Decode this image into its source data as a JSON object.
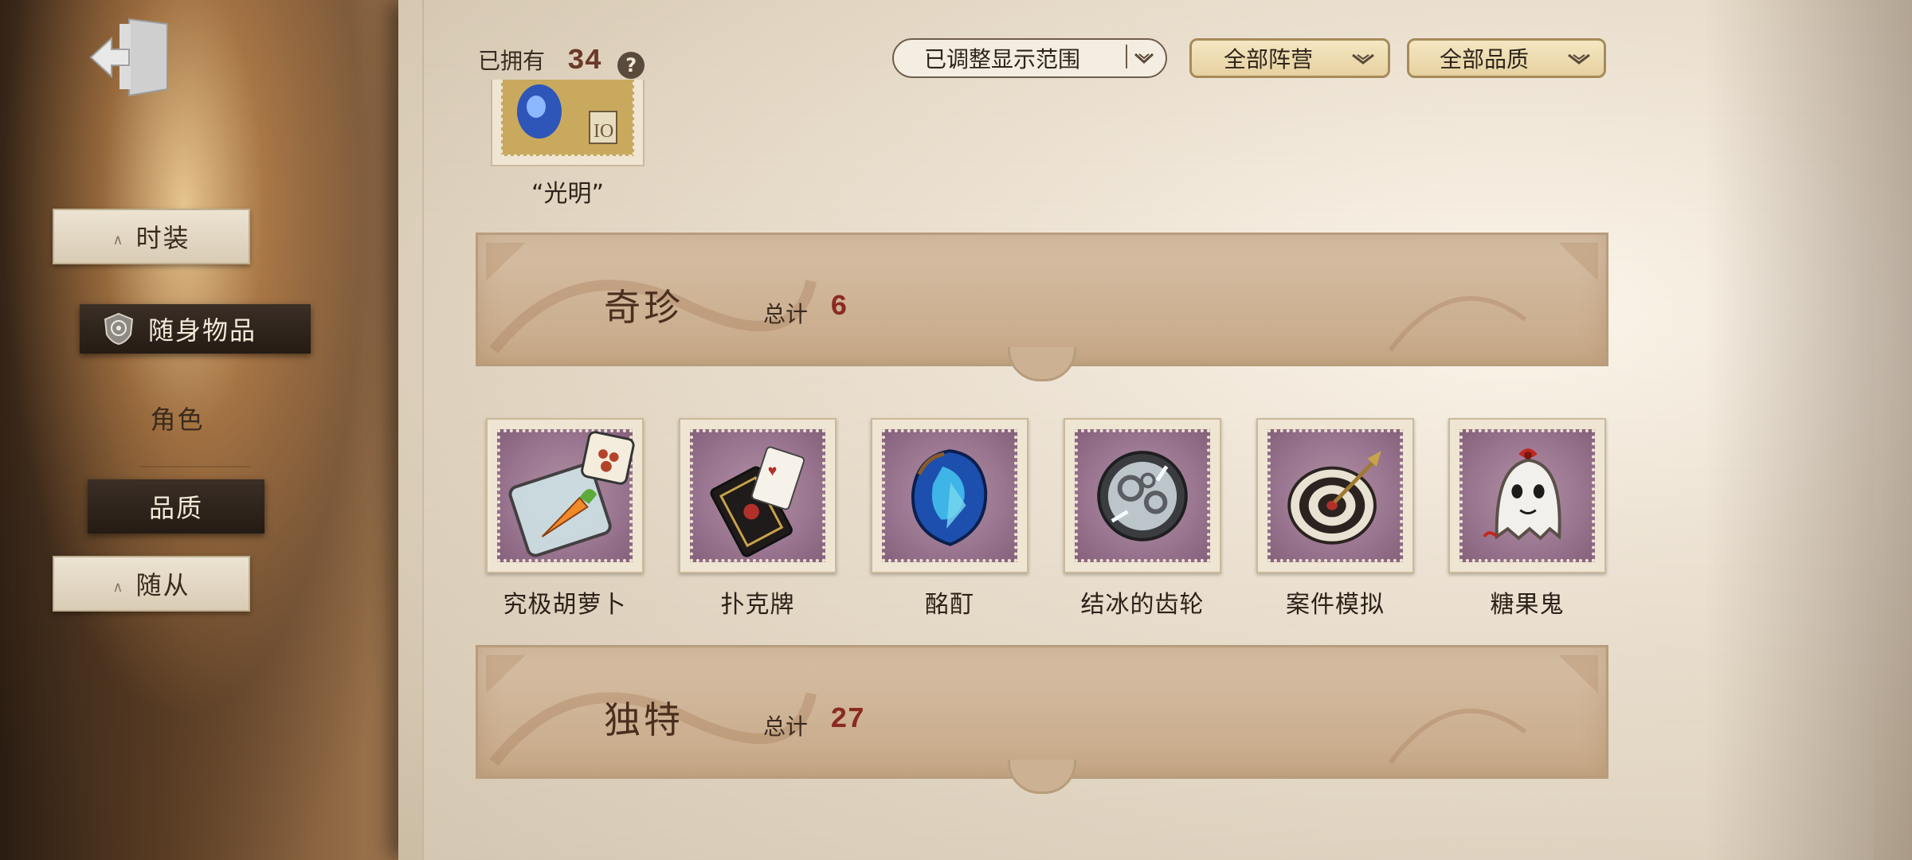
{
  "nav": {
    "exit_icon": "exit-door-icon",
    "items": [
      {
        "label": "时装",
        "state": "normal"
      },
      {
        "label": "随身物品",
        "state": "active",
        "icon": "emblem-icon"
      },
      {
        "label": "角色",
        "state": "plain"
      },
      {
        "label": "品质",
        "state": "active-sub"
      },
      {
        "label": "随从",
        "state": "normal"
      }
    ]
  },
  "header": {
    "owned_label": "已拥有",
    "owned_count": "34",
    "help_icon": "?",
    "filters": [
      {
        "label": "已调整显示范围"
      },
      {
        "label": "全部阵营"
      },
      {
        "label": "全部品质"
      }
    ]
  },
  "top_item": {
    "label": "“光明”"
  },
  "sections": [
    {
      "title": "奇珍",
      "count_label": "总计",
      "count": "6"
    },
    {
      "title": "独特",
      "count_label": "总计",
      "count": "27"
    }
  ],
  "items": [
    {
      "label": "究极胡萝卜",
      "icon": "carrot-jar-icon"
    },
    {
      "label": "扑克牌",
      "icon": "playing-cards-icon"
    },
    {
      "label": "酩酊",
      "icon": "crystal-heart-icon"
    },
    {
      "label": "结冰的齿轮",
      "icon": "frozen-gear-icon"
    },
    {
      "label": "案件模拟",
      "icon": "dartboard-icon"
    },
    {
      "label": "糖果鬼",
      "icon": "candy-ghost-icon"
    }
  ],
  "colors": {
    "accent_red": "#8a2a20",
    "stamp_purple": "#9a7690",
    "banner": "#cdb193"
  }
}
